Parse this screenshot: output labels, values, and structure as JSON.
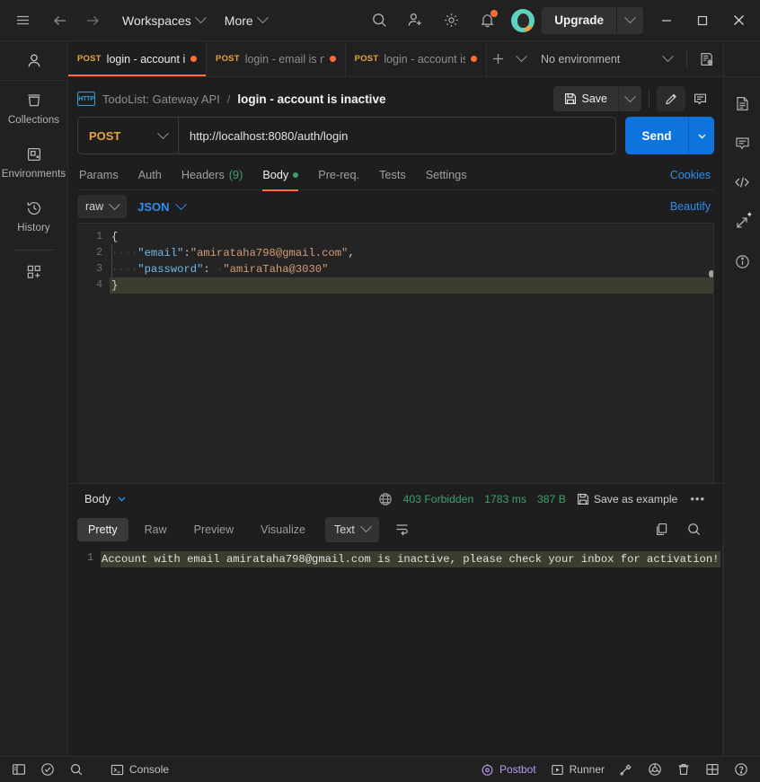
{
  "titlebar": {
    "menu_icon": "hamburger-icon",
    "back_icon": "arrow-left-icon",
    "forward_icon": "arrow-right-icon",
    "workspaces_label": "Workspaces",
    "more_label": "More",
    "search_icon": "search-icon",
    "invite_icon": "user-add-icon",
    "settings_icon": "gear-icon",
    "notifications_icon": "bell-icon",
    "avatar_label": "avatar",
    "upgrade_label": "Upgrade",
    "minimize_label": "–",
    "maximize_label": "□",
    "close_label": "✕"
  },
  "sidebar": {
    "profile_icon": "user-icon",
    "items": [
      {
        "label": "Collections",
        "icon": "collections-icon"
      },
      {
        "label": "Environments",
        "icon": "environments-icon"
      },
      {
        "label": "History",
        "icon": "history-icon"
      }
    ],
    "apps_icon": "apps-grid-icon"
  },
  "tabs": {
    "items": [
      {
        "method": "POST",
        "label": "login - account is in",
        "dirty": true,
        "active": true
      },
      {
        "method": "POST",
        "label": "login - email is not f",
        "dirty": true,
        "active": false
      },
      {
        "method": "POST",
        "label": "login - account is ac",
        "dirty": true,
        "active": false
      }
    ],
    "new_tab_icon": "plus-icon",
    "tab_list_icon": "chevron-down-icon",
    "environment_selected": "No environment",
    "environment_caret_icon": "chevron-down-icon",
    "env_quick_look_icon": "eye-environment-icon"
  },
  "request": {
    "protocol_badge": "HTTP",
    "collection_name": "TodoList: Gateway API",
    "breadcrumb_separator": "/",
    "request_name": "login - account is inactive",
    "save_label": "Save",
    "save_icon": "floppy-disk-icon",
    "save_caret_icon": "chevron-down-icon",
    "edit_icon": "pencil-icon",
    "comment_icon": "comment-icon",
    "method": "POST",
    "method_caret_icon": "chevron-down-icon",
    "url": "http://localhost:8080/auth/login",
    "send_label": "Send",
    "send_caret_icon": "chevron-down-icon",
    "tabs": [
      {
        "label": "Params",
        "active": false
      },
      {
        "label": "Auth",
        "active": false
      },
      {
        "label": "Headers",
        "count": "(9)",
        "active": false
      },
      {
        "label": "Body",
        "active": true,
        "dot": true
      },
      {
        "label": "Pre-req.",
        "active": false
      },
      {
        "label": "Tests",
        "active": false
      },
      {
        "label": "Settings",
        "active": false
      }
    ],
    "cookies_label": "Cookies",
    "body_mode": "raw",
    "body_format": "JSON",
    "beautify_label": "Beautify",
    "body_lines": [
      {
        "n": "1",
        "text": "{"
      },
      {
        "n": "2",
        "text": "    \"email\":\"amirataha798@gmail.com\","
      },
      {
        "n": "3",
        "text": "    \"password\": \"amiraTaha@3030\""
      },
      {
        "n": "4",
        "text": "}"
      }
    ]
  },
  "response": {
    "body_selector_label": "Body",
    "body_selector_caret": "chevron-down-icon",
    "globe_icon": "globe-icon",
    "status": "403 Forbidden",
    "time": "1783 ms",
    "size": "387 B",
    "save_example_label": "Save as example",
    "save_example_icon": "floppy-disk-icon",
    "more_icon": "ellipsis-icon",
    "tabs": [
      {
        "label": "Pretty",
        "active": true
      },
      {
        "label": "Raw",
        "active": false
      },
      {
        "label": "Preview",
        "active": false
      },
      {
        "label": "Visualize",
        "active": false
      }
    ],
    "format": "Text",
    "format_caret_icon": "chevron-down-icon",
    "wrap_icon": "word-wrap-icon",
    "copy_icon": "copy-icon",
    "search_icon": "search-icon",
    "line_number": "1",
    "body_text": "Account with email amirataha798@gmail.com is inactive, please check your inbox for activation!"
  },
  "right_rail": {
    "items": [
      {
        "icon": "documentation-icon"
      },
      {
        "icon": "comment-icon"
      },
      {
        "icon": "code-icon"
      },
      {
        "icon": "fork-icon"
      },
      {
        "icon": "info-icon"
      }
    ]
  },
  "statusbar": {
    "sidebar_toggle_icon": "panel-toggle-icon",
    "check_icon": "check-circle-icon",
    "find_icon": "search-icon",
    "console_label": "Console",
    "console_icon": "terminal-icon",
    "postbot_label": "Postbot",
    "postbot_icon": "postbot-icon",
    "runner_label": "Runner",
    "runner_icon": "play-box-icon",
    "cookies_icon": "cookie-plug-icon",
    "vault_icon": "vault-icon",
    "trash_icon": "trash-icon",
    "layout_icon": "layout-icon",
    "help_icon": "help-circle-icon"
  },
  "colors": {
    "accent": "#ff6c37",
    "send": "#0e74dc",
    "status_ok": "#3ea06c",
    "link": "#2f8ef0",
    "method": "#e8a33d"
  }
}
